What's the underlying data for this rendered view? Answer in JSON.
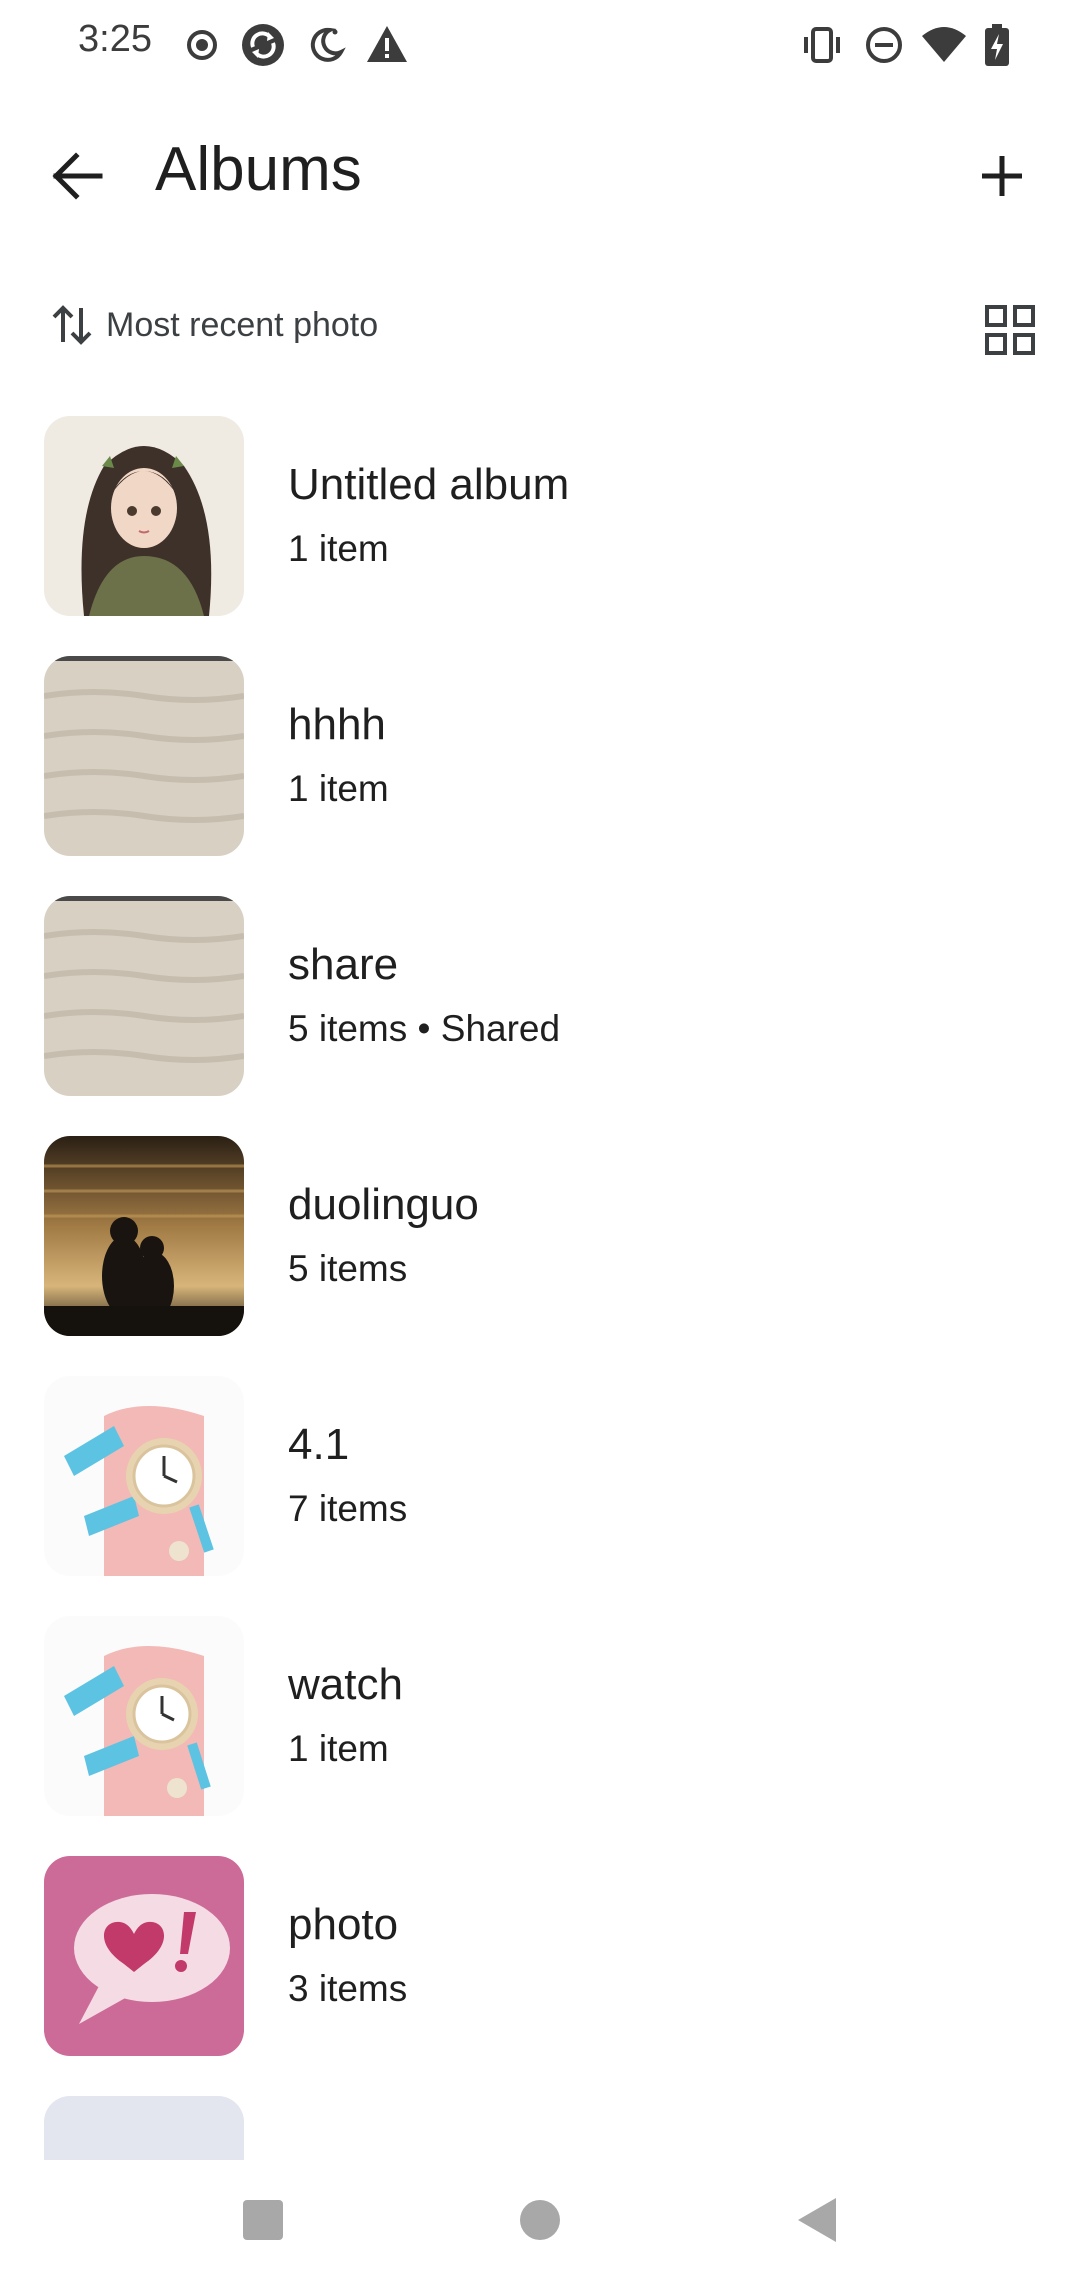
{
  "status_bar": {
    "time": "3:25",
    "left_icons": [
      "record-icon",
      "sync-icon",
      "night-mode-icon",
      "warning-icon"
    ],
    "right_icons": [
      "vibrate-icon",
      "do-not-disturb-icon",
      "wifi-icon",
      "battery-charging-icon"
    ]
  },
  "app_bar": {
    "title": "Albums",
    "back_icon": "arrow-back-icon",
    "add_icon": "plus-icon"
  },
  "sort": {
    "label": "Most recent photo",
    "icon": "sort-arrows-icon",
    "view_toggle_icon": "grid-view-icon"
  },
  "albums": [
    {
      "name": "Untitled album",
      "count": "1 item"
    },
    {
      "name": "hhhh",
      "count": "1 item"
    },
    {
      "name": "share",
      "count": "5 items • Shared"
    },
    {
      "name": "duolinguo",
      "count": "5 items"
    },
    {
      "name": "4.1",
      "count": "7 items"
    },
    {
      "name": "watch",
      "count": "1 item"
    },
    {
      "name": "photo",
      "count": "3 items"
    }
  ],
  "nav_bar": {
    "icons": [
      "recents-square-icon",
      "home-circle-icon",
      "back-triangle-icon"
    ]
  },
  "colors": {
    "text_primary": "#1f1f1f",
    "text_secondary": "#3c4043",
    "photo_pink": "#cc6b97"
  }
}
